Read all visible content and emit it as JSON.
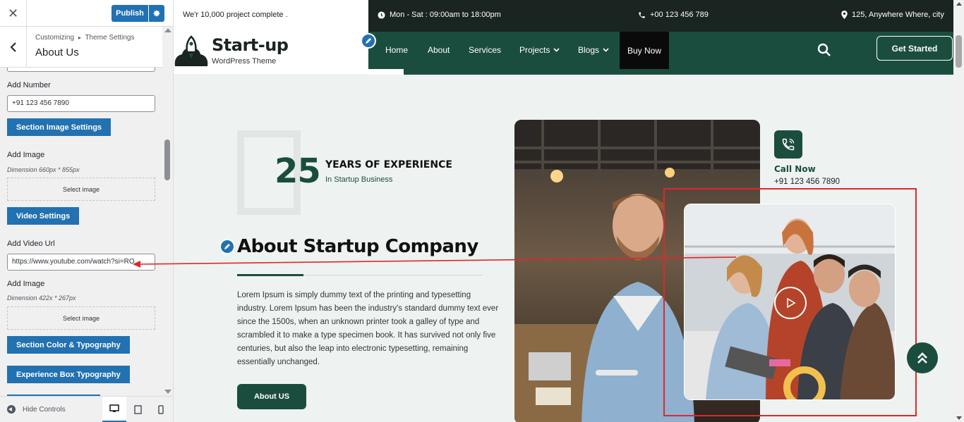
{
  "customizer": {
    "publish_label": "Publish",
    "breadcrumb_root": "Customizing",
    "breadcrumb_sep": "▸",
    "breadcrumb_section": "Theme Settings",
    "section_title": "About Us",
    "add_number_label": "Add Number",
    "add_number_value": "+91 123 456 7890",
    "section_image_settings": "Section Image Settings",
    "add_image_label_1": "Add Image",
    "dimension_1": "Dimension 660px * 855px",
    "select_image_1": "Select image",
    "video_settings": "Video Settings",
    "add_video_url_label": "Add Video Url",
    "add_video_url_value": "https://www.youtube.com/watch?si=RO",
    "add_image_label_2": "Add Image",
    "dimension_2": "Dimension 422x * 267px",
    "select_image_2": "Select image",
    "section_color_typography": "Section Color & Typography",
    "experience_box_typography": "Experience Box Typography",
    "hide_controls": "Hide Controls",
    "accent": "#2271b1"
  },
  "site": {
    "topbar_left": "We'r 10,000 project complete .",
    "hours": "Mon - Sat : 09:00am to 18:00pm",
    "phone": "+00 123 456 789",
    "address": "125, Anywhere Where, city",
    "logo_title": "Start-up",
    "logo_sub": "WordPress Theme",
    "nav": {
      "home": "Home",
      "about": "About",
      "services": "Services",
      "projects": "Projects",
      "blogs": "Blogs",
      "buy_now": "Buy Now",
      "cta": "Get Started"
    },
    "experience": {
      "number": "25",
      "title": "YEARS OF EXPERIENCE",
      "subtitle": "In Startup Business"
    },
    "about_heading": "About Startup Company",
    "about_text": "Lorem Ipsum is simply dummy text of the printing and typesetting industry. Lorem Ipsum has been the industry's standard dummy text ever since the 1500s, when an unknown printer took a galley of type and scrambled it to make a type specimen book. It has survived not only five centuries, but also the leap into electronic typesetting, remaining essentially unchanged.",
    "about_button": "About US",
    "call_label": "Call Now",
    "call_number": "+91 123 456 7890",
    "brand_green": "#1b4d3e",
    "highlight_red": "#e2262a"
  }
}
